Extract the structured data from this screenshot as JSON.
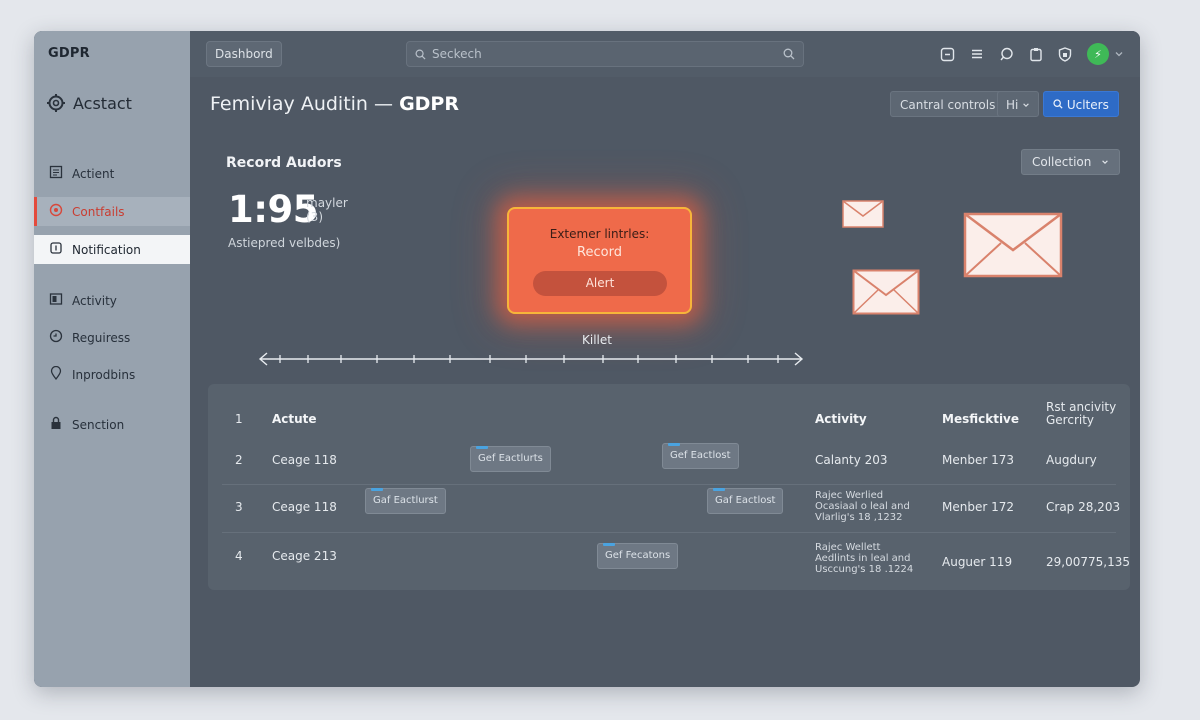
{
  "sidebar": {
    "logo": "GDPR",
    "workspace": "Acstact",
    "items": [
      {
        "label": "Actient",
        "icon": "list-icon"
      },
      {
        "label": "Contfails",
        "icon": "target-icon"
      },
      {
        "label": "Notification",
        "icon": "notification-icon"
      },
      {
        "label": "Activity",
        "icon": "activity-icon"
      },
      {
        "label": "Reguiress",
        "icon": "requests-icon"
      },
      {
        "label": "Inprodbins",
        "icon": "location-pin-icon"
      },
      {
        "label": "Senction",
        "icon": "lock-icon"
      }
    ]
  },
  "topbar": {
    "dashboard": "Dashbord",
    "search_placeholder": "Seckech",
    "avatar_letter": "⚡"
  },
  "header": {
    "title": "Femiviay Auditin",
    "separator": " — ",
    "title_strong": "GDPR",
    "central_controls": "Cantral controls",
    "hi": "Hi",
    "users": "Uclters"
  },
  "record": {
    "title": "Record Audors",
    "collection": "Collection",
    "value": "1:95",
    "unit": "mayler",
    "unit_count": "(3)",
    "sub": "Astiepred velbdes)",
    "alert_title": "Extemer lintrles:",
    "alert_record": "Record",
    "alert_button": "Alert",
    "timeline_label": "Killet"
  },
  "table": {
    "headers": {
      "num": "1",
      "name": "Actute",
      "activity": "Activity",
      "mesfictive": "Mesficktive",
      "last_line1": "Rst ancivity",
      "last_line2": "Gercrity"
    },
    "rows": [
      {
        "num": "2",
        "name": "Ceage 118",
        "chips": [
          "Gef Eactlurts",
          "Gef Eactlost"
        ],
        "activity": "Calanty 203",
        "member": "Menber 173",
        "last": "Augdury"
      },
      {
        "num": "3",
        "name": "Ceage 118",
        "chips": [
          "Gaf Eactlurst",
          "Gaf Eactlost"
        ],
        "activity_lines": [
          "Rajec Werlied",
          "Ocasiaal o leal and",
          "Vlarlig's 18 ,1232"
        ],
        "member": "Menber 172",
        "last": "Crap 28,203"
      },
      {
        "num": "4",
        "name": "Ceage 213",
        "chips": [
          "Gef Fecatons"
        ],
        "activity_lines": [
          "Rajec Wellett",
          "Aedlints in leal and",
          "Usccung's 18 .1224"
        ],
        "member": "Auguer 119",
        "last": "29,00775,135"
      }
    ]
  },
  "colors": {
    "accent_red": "#e44a3c",
    "alert_orange": "#ef6a4a",
    "primary_blue": "#2e6bc6",
    "status_green": "#3fb957"
  }
}
